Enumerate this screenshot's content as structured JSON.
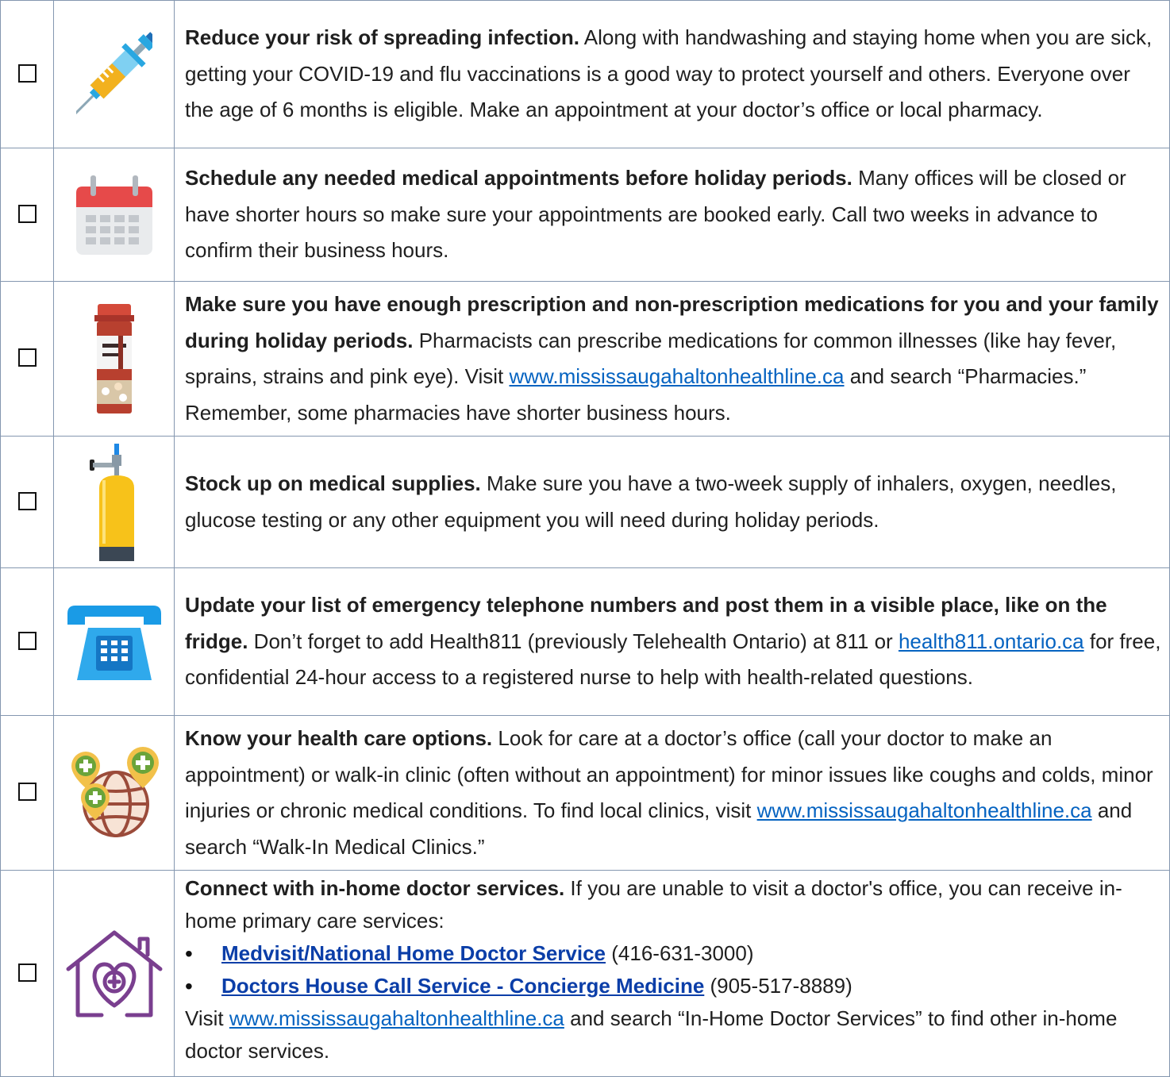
{
  "items": [
    {
      "icon": "syringe-icon",
      "title": "Reduce your risk of spreading infection.",
      "body": " Along with handwashing and staying home when you are sick, getting your COVID-19 and flu vaccinations is a good way to protect yourself and others. Everyone over the age of 6 months is eligible. Make an appointment at your doctor’s office or local pharmacy."
    },
    {
      "icon": "calendar-icon",
      "title": "Schedule any needed medical appointments before holiday periods.",
      "body": " Many offices will be closed or have shorter hours so make sure your appointments are booked early. Call two weeks in advance to confirm their business hours."
    },
    {
      "icon": "medication-bottle-icon",
      "title": "Make sure you have enough prescription and non-prescription medications for you and your family during holiday periods.",
      "body_before": " Pharmacists can prescribe medications for common illnesses (like hay fever, sprains, strains and pink eye). Visit ",
      "link": "www.mississaugahaltonhealthline.ca",
      "body_after": " and search “Pharmacies.” Remember, some pharmacies have shorter business hours."
    },
    {
      "icon": "oxygen-tank-icon",
      "title": "Stock up on medical supplies.",
      "body": " Make sure you have a two-week supply of inhalers, oxygen, needles, glucose testing or any other equipment you will need during holiday periods."
    },
    {
      "icon": "telephone-icon",
      "title": "Update your list of emergency telephone numbers and post them in a visible place, like on the fridge.",
      "body_before": " Don’t forget to add Health811 (previously Telehealth Ontario) at 811 or ",
      "link": "health811.ontario.ca",
      "body_after": " for free, confidential 24-hour access to a registered nurse to help with health-related questions."
    },
    {
      "icon": "globe-health-locations-icon",
      "title": "Know your health care options.",
      "body_before": " Look for care at a doctor’s office (call your doctor to make an appointment) or walk-in clinic (often without an appointment) for minor issues like coughs and colds, minor injuries or chronic medical conditions. To find local clinics, visit ",
      "link": "www.mississaugahaltonhealthline.ca",
      "body_after": " and search “Walk-In Medical Clinics.”"
    },
    {
      "icon": "home-heart-care-icon",
      "title": "Connect with in-home doctor services.",
      "body": " If you are unable to visit a doctor's office, you can receive in-home primary care services:",
      "bullets": [
        {
          "link": "Medvisit/National Home Doctor Service",
          "phone": " (416-631-3000)"
        },
        {
          "link": "Doctors House Call Service - Concierge Medicine",
          "phone": " (905-517-8889)"
        }
      ],
      "visit": "Visit ",
      "link": "www.mississaugahaltonhealthline.ca",
      "body_after": " and search “In-Home Doctor Services” to find other in-home doctor services."
    }
  ]
}
